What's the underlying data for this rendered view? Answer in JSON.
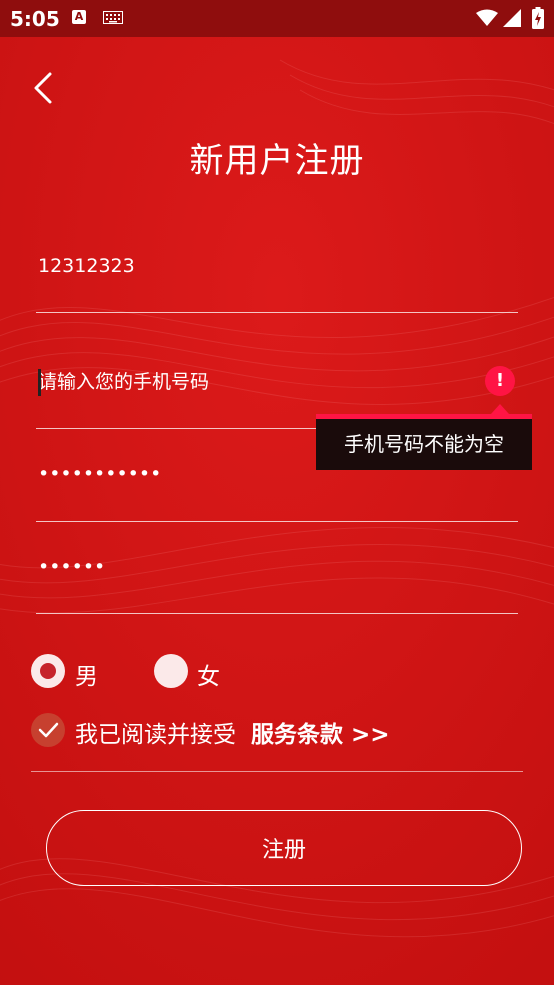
{
  "status_bar": {
    "time": "5:05",
    "notification_glyph": "A",
    "icons": [
      "keyboard-icon",
      "wifi-icon",
      "signal-icon",
      "battery-charging-icon"
    ]
  },
  "header": {
    "back_icon": "chevron-left-icon",
    "title": "新用户注册"
  },
  "form": {
    "username": {
      "value": "12312323",
      "placeholder": ""
    },
    "phone": {
      "value": "",
      "placeholder": "请输入您的手机号码",
      "error_icon": "exclamation-icon",
      "error_mark": "!"
    },
    "tooltip": "手机号码不能为空",
    "password": {
      "value": "•••••••••••"
    },
    "confirm_password": {
      "value": "••••••"
    },
    "gender": {
      "options": [
        {
          "label": "男",
          "selected": true
        },
        {
          "label": "女",
          "selected": false
        }
      ]
    },
    "agreement": {
      "checked": true,
      "text": "我已阅读并接受",
      "link": "服务条款 >>"
    },
    "submit_label": "注册"
  },
  "colors": {
    "background": "#cc1212",
    "status_bar": "#8f0d0d",
    "error": "#ff1444",
    "tooltip_bg": "#1a0b0b",
    "radio_selected_dot": "#c6232b",
    "checkbox_fill": "#c7402f"
  }
}
